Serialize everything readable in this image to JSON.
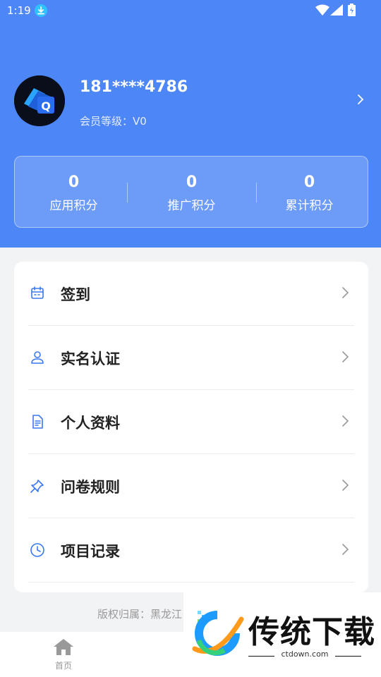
{
  "status_bar": {
    "time": "1:19"
  },
  "profile": {
    "phone": "181****4786",
    "level_label": "会员等级：V0"
  },
  "stats": [
    {
      "value": "0",
      "label": "应用积分"
    },
    {
      "value": "0",
      "label": "推广积分"
    },
    {
      "value": "0",
      "label": "累计积分"
    }
  ],
  "menu": [
    {
      "label": "签到",
      "icon": "calendar-icon"
    },
    {
      "label": "实名认证",
      "icon": "user-icon"
    },
    {
      "label": "个人资料",
      "icon": "document-icon"
    },
    {
      "label": "问卷规则",
      "icon": "pin-icon"
    },
    {
      "label": "项目记录",
      "icon": "clock-icon"
    }
  ],
  "footer": {
    "copyright": "版权归属：黑龙江"
  },
  "tabbar": {
    "home_label": "首页"
  },
  "watermark": {
    "title": "传统下载",
    "url": "ctdown.com"
  },
  "colors": {
    "brand_blue": "#4d86f7",
    "icon_blue": "#3a78f2"
  }
}
